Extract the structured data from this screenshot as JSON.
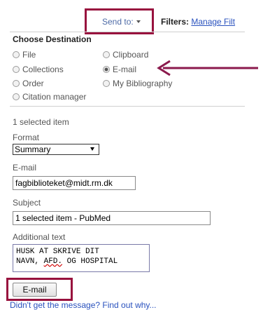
{
  "header": {
    "send_to_label": "Send to:",
    "filters_label": "Filters:",
    "manage_filters_link": "Manage Filt"
  },
  "destination": {
    "title": "Choose Destination",
    "options": [
      {
        "label": "File",
        "selected": false
      },
      {
        "label": "Clipboard",
        "selected": false
      },
      {
        "label": "Collections",
        "selected": false
      },
      {
        "label": "E-mail",
        "selected": true
      },
      {
        "label": "Order",
        "selected": false
      },
      {
        "label": "My Bibliography",
        "selected": false
      },
      {
        "label": "Citation manager",
        "selected": false
      }
    ]
  },
  "email_form": {
    "selected_count": "1 selected item",
    "format_label": "Format",
    "format_value": "Summary",
    "email_label": "E-mail",
    "email_value": "fagbiblioteket@midt.rm.dk",
    "subject_label": "Subject",
    "subject_value": "1 selected item - PubMed",
    "additional_label": "Additional text",
    "additional_line1": "HUSK AT SKRIVE DIT",
    "additional_line2_part1": "NAVN, ",
    "additional_line2_part2": "AFD.",
    "additional_line2_part3": " OG HOSPITAL",
    "submit_label": "E-mail",
    "help_link": "Didn't get the message? Find out why..."
  },
  "colors": {
    "highlight_box": "#98123e",
    "link": "#2a52be",
    "arrow": "#8b1a4d"
  },
  "icons": [
    "dropdown-caret-icon",
    "radio-icon",
    "arrow-pointer-icon"
  ]
}
